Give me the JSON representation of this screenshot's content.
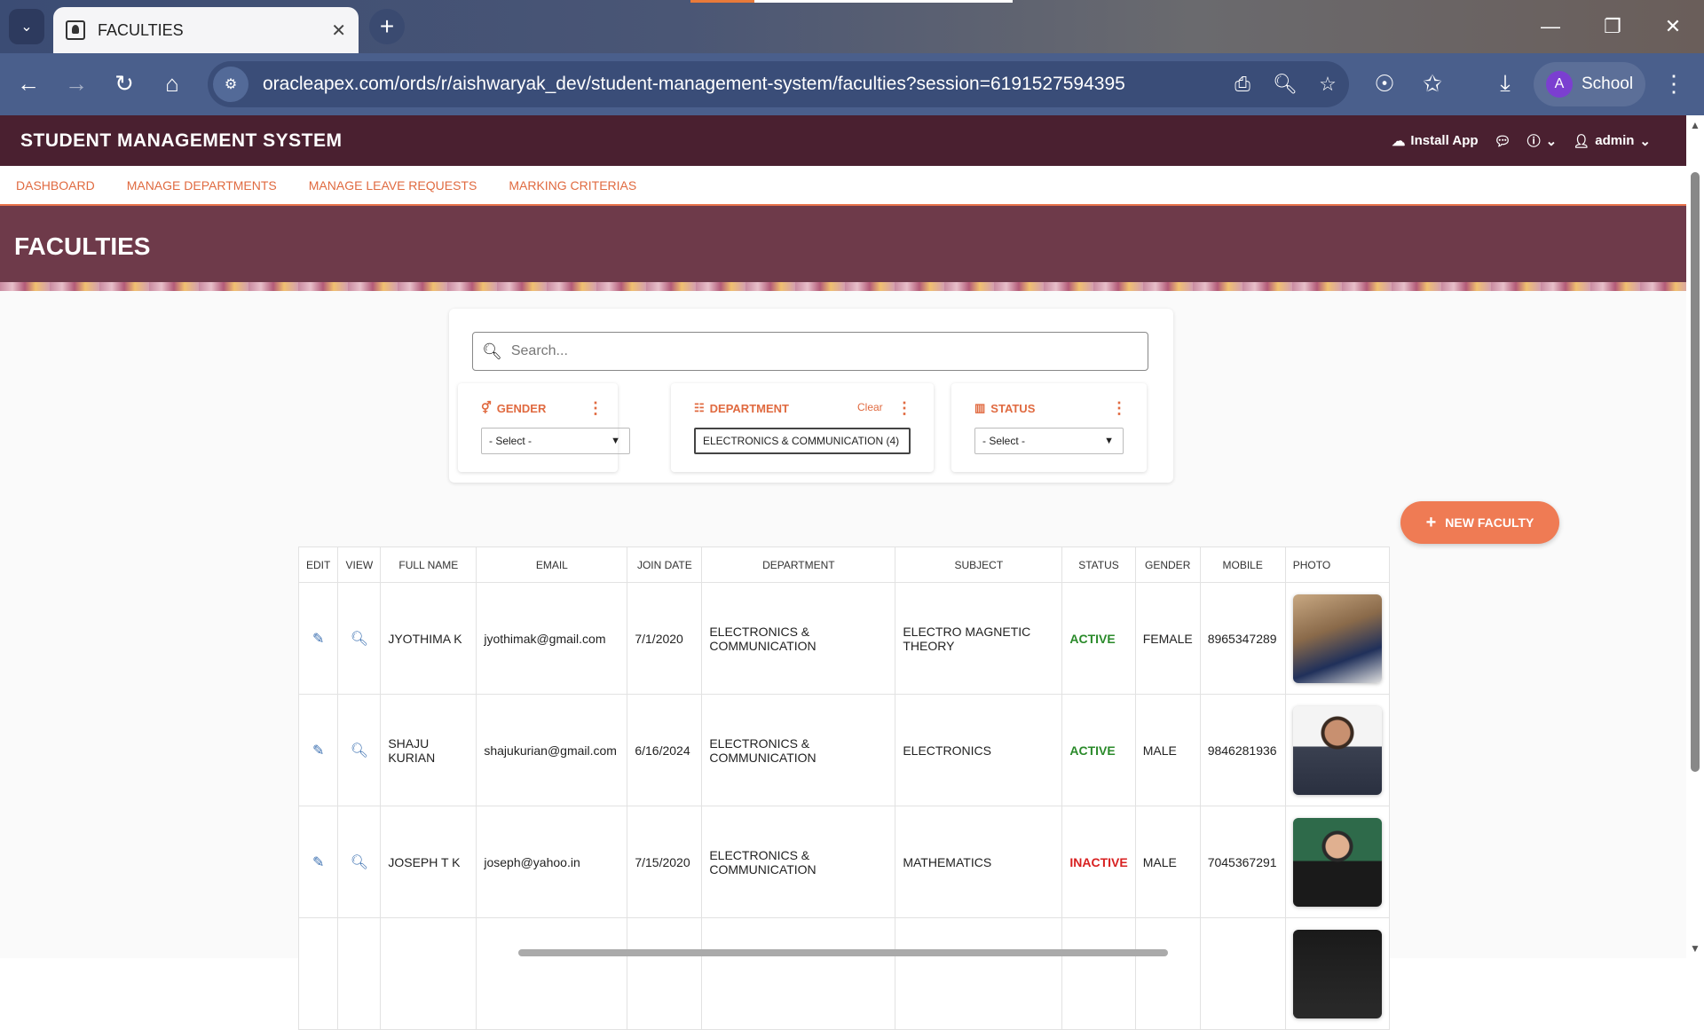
{
  "browser": {
    "tab_title": "FACULTIES",
    "tab_close": "✕",
    "new_tab": "+",
    "url": "oracleapex.com/ords/r/aishwaryak_dev/student-management-system/faculties?session=6191527594395",
    "profile_initial": "A",
    "profile_name": "School",
    "window_min": "—",
    "window_restore": "❐",
    "window_close": "✕"
  },
  "app": {
    "title": "STUDENT MANAGEMENT SYSTEM",
    "install_label": "Install App",
    "user_label": "admin"
  },
  "menu": [
    "DASHBOARD",
    "MANAGE DEPARTMENTS",
    "MANAGE LEAVE REQUESTS",
    "MARKING CRITERIAS"
  ],
  "page": {
    "title": "FACULTIES"
  },
  "search": {
    "placeholder": "Search..."
  },
  "facets": {
    "gender": {
      "label": "GENDER",
      "value": "- Select -"
    },
    "department": {
      "label": "DEPARTMENT",
      "clear": "Clear",
      "value": "ELECTRONICS & COMMUNICATION (4)"
    },
    "status": {
      "label": "STATUS",
      "value": "- Select -"
    }
  },
  "new_faculty_label": "NEW FACULTY",
  "table": {
    "headers": [
      "EDIT",
      "VIEW",
      "FULL NAME",
      "EMAIL",
      "JOIN DATE",
      "DEPARTMENT",
      "SUBJECT",
      "STATUS",
      "GENDER",
      "MOBILE",
      "PHOTO"
    ],
    "rows": [
      {
        "name": "JYOTHIMA K",
        "email": "jyothimak@gmail.com",
        "join": "7/1/2020",
        "dept": "ELECTRONICS & COMMUNICATION",
        "subject": "ELECTRO MAGNETIC THEORY",
        "status": "ACTIVE",
        "gender": "FEMALE",
        "mobile": "8965347289"
      },
      {
        "name": "SHAJU KURIAN",
        "email": "shajukurian@gmail.com",
        "join": "6/16/2024",
        "dept": "ELECTRONICS & COMMUNICATION",
        "subject": "ELECTRONICS",
        "status": "ACTIVE",
        "gender": "MALE",
        "mobile": "9846281936"
      },
      {
        "name": "JOSEPH T K",
        "email": "joseph@yahoo.in",
        "join": "7/15/2020",
        "dept": "ELECTRONICS & COMMUNICATION",
        "subject": "MATHEMATICS",
        "status": "INACTIVE",
        "gender": "MALE",
        "mobile": "7045367291"
      }
    ]
  },
  "colors": {
    "header": "#4a2030",
    "hero": "#6e3a4a",
    "accent": "#e06a40",
    "active": "#2a8a2a",
    "inactive": "#d82020"
  }
}
